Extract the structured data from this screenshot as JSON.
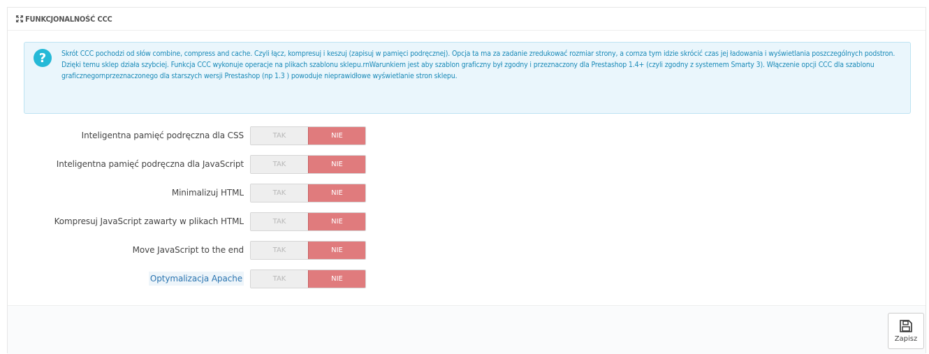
{
  "panel": {
    "heading_icon": "resize-icon",
    "title": "FUNKCJONALNOŚĆ CCC"
  },
  "alert": {
    "icon": "question-circle-icon",
    "text": "Skrót CCC pochodzi od słów combine, compress and cache. Czyli łącz, kompresuj i keszuj (zapisuj w pamięci podręcznej). Opcja ta ma za zadanie zredukować rozmiar strony, a cornza tym idzie skrócić czas jej ładowania i wyświetlania poszczególnych podstron. Dzięki temu sklep działa szybciej. Funkcja CCC wykonuje operacje na plikach szablonu sklepu.rnWarunkiem jest aby szablon graficzny był zgodny i przeznaczony dla Prestashop 1.4+ (czyli zgodny z systemem Smarty 3). Włączenie opcji CCC dla szablonu graficznegornprzeznaczonego dla starszych wersji Prestashop (np 1.3 ) powoduje nieprawidłowe wyświetlanie stron sklepu."
  },
  "switch_labels": {
    "yes": "TAK",
    "no": "NIE"
  },
  "rows": [
    {
      "label": "Inteligentna pamięć podręczna dla CSS",
      "value": "NIE",
      "link": false
    },
    {
      "label": "Inteligentna pamięć podręczna dla JavaScript",
      "value": "NIE",
      "link": false
    },
    {
      "label": "Minimalizuj HTML",
      "value": "NIE",
      "link": false
    },
    {
      "label": "Kompresuj JavaScript zawarty w plikach HTML",
      "value": "NIE",
      "link": false
    },
    {
      "label": "Move JavaScript to the end",
      "value": "NIE",
      "link": false
    },
    {
      "label": "Optymalizacja Apache",
      "value": "NIE",
      "link": true
    }
  ],
  "footer": {
    "save_icon": "save-icon",
    "save_label": "Zapisz"
  },
  "colors": {
    "alert_bg": "#eaf6fc",
    "alert_text": "#1a8ab8",
    "switch_off": "#e07b7d",
    "link": "#2a74b0"
  }
}
